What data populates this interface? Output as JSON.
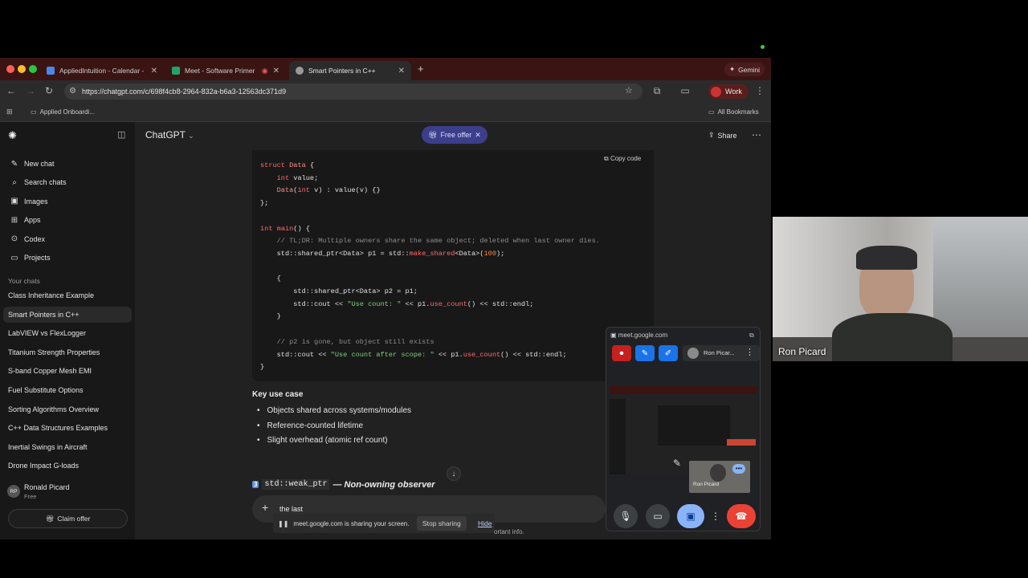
{
  "browser": {
    "tabs": [
      {
        "title": "AppliedIntuition - Calendar -",
        "favicon_color": "#4a86e8"
      },
      {
        "title": "Meet - Software Primer S",
        "favicon_color": "#22a36b"
      },
      {
        "title": "Smart Pointers in C++",
        "favicon_color": "#9a9a9a"
      }
    ],
    "gemini_label": "Gemini",
    "url": "https://chatgpt.com/c/698f4cb8-2964-832a-b6a3-12563dc371d9",
    "profile_label": "Work",
    "bookmark": "Applied Onboardi...",
    "all_bookmarks": "All Bookmarks"
  },
  "sidebar": {
    "nav": [
      {
        "label": "New chat",
        "icon": "edit-icon"
      },
      {
        "label": "Search chats",
        "icon": "search-icon"
      },
      {
        "label": "Images",
        "icon": "image-icon"
      },
      {
        "label": "Apps",
        "icon": "apps-icon"
      },
      {
        "label": "Codex",
        "icon": "codex-icon"
      },
      {
        "label": "Projects",
        "icon": "folder-icon"
      }
    ],
    "section_title": "Your chats",
    "chats": [
      "Class Inheritance Example",
      "Smart Pointers in C++",
      "LabVIEW vs FlexLogger",
      "Titanium Strength Properties",
      "S-band Copper Mesh EMI",
      "Fuel Substitute Options",
      "Sorting Algorithms Overview",
      "C++ Data Structures Examples",
      "Inertial Swings in Aircraft",
      "Drone Impact G-loads"
    ],
    "active_chat_index": 1,
    "user": {
      "name": "Ronald Picard",
      "plan": "Free",
      "initials": "RP"
    },
    "claim_label": "Claim offer"
  },
  "header": {
    "title": "ChatGPT",
    "free_offer": "Free offer",
    "share": "Share"
  },
  "code": {
    "copy_label": "Copy code",
    "lines": [
      "struct Data {",
      "    int value;",
      "    Data(int v) : value(v) {}",
      "};",
      "",
      "int main() {",
      "    // TL;DR: Multiple owners share the same object; deleted when last owner dies.",
      "    std::shared_ptr<Data> p1 = std::make_shared<Data>(100);",
      "",
      "    {",
      "        std::shared_ptr<Data> p2 = p1;",
      "        std::cout << \"Use count: \" << p1.use_count() << std::endl;",
      "    }",
      "",
      "    // p2 is gone, but object still exists",
      "    std::cout << \"Use count after scope: \" << p1.use_count() << std::endl;",
      "}"
    ]
  },
  "content": {
    "key_use_title": "Key use case",
    "bullets": [
      "Objects shared across systems/modules",
      "Reference-counted lifetime",
      "Slight overhead (atomic ref count)"
    ],
    "section3_num": "3",
    "section3_code": "std::weak_ptr",
    "section3_text": "— Non-owning observer"
  },
  "composer": {
    "text": "the last",
    "disclaimer": "ortant info."
  },
  "share_bar": {
    "message": "meet.google.com is sharing your screen.",
    "stop": "Stop sharing",
    "hide": "Hide"
  },
  "meet": {
    "url": "meet.google.com",
    "participant": "Ron Picar...",
    "tile_name": "Ron Picard"
  },
  "video": {
    "name": "Ron Picard"
  }
}
